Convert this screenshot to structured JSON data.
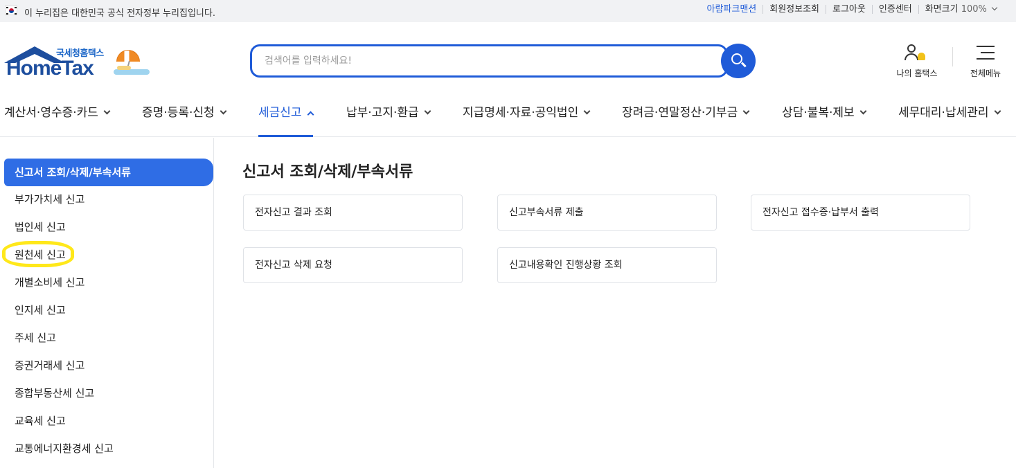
{
  "gov_banner": {
    "text": "이 누리집은 대한민국 공식 전자정부 누리집입니다.",
    "links": [
      "아람파크맨션",
      "회원정보조회",
      "로그아웃",
      "인증센터",
      "화면크기"
    ],
    "zoom": "100%"
  },
  "logo": {
    "sub": "국세청홈택스",
    "main": "HomeTax"
  },
  "search": {
    "placeholder": "검색어를 입력하세요!"
  },
  "header_icons": {
    "my_home": "나의 홈택스",
    "all_menu": "전체메뉴"
  },
  "gnb": [
    {
      "label": "계산서·영수증·카드",
      "active": false
    },
    {
      "label": "증명·등록·신청",
      "active": false
    },
    {
      "label": "세금신고",
      "active": true
    },
    {
      "label": "납부·고지·환급",
      "active": false
    },
    {
      "label": "지급명세·자료·공익법인",
      "active": false
    },
    {
      "label": "장려금·연말정산·기부금",
      "active": false
    },
    {
      "label": "상담·불복·제보",
      "active": false
    },
    {
      "label": "세무대리·납세관리",
      "active": false
    }
  ],
  "sidebar": [
    "신고서 조회/삭제/부속서류",
    "부가가치세 신고",
    "법인세 신고",
    "원천세 신고",
    "개별소비세 신고",
    "인지세 신고",
    "주세 신고",
    "증권거래세 신고",
    "종합부동산세 신고",
    "교육세 신고",
    "교통에너지환경세 신고"
  ],
  "content": {
    "title": "신고서 조회/삭제/부속서류",
    "cards": [
      "전자신고 결과 조회",
      "신고부속서류 제출",
      "전자신고 접수증·납부서 출력",
      "전자신고 삭제 요청",
      "신고내용확인 진행상황 조회"
    ]
  },
  "colors": {
    "accent": "#1f5bd8",
    "active_sidebar": "#2f6de5",
    "highlight": "#ffe81a"
  }
}
